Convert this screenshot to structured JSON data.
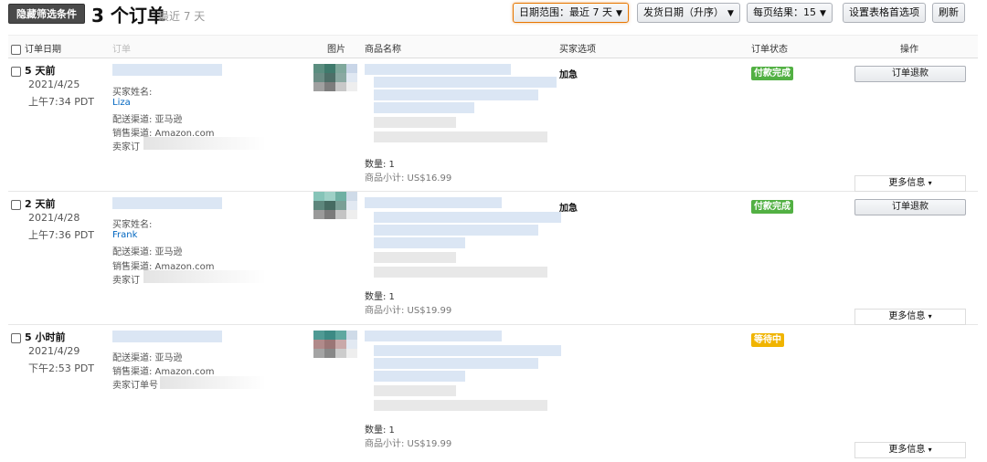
{
  "toolbar": {
    "hide_filters_label": "隐藏筛选条件",
    "order_count": "3 个订单",
    "range_note": "最近 7 天",
    "date_range_label": "日期范围：最近 7 天",
    "sort_label": "发货日期（升序）",
    "per_page_label": "每页结果：15",
    "table_prefs_label": "设置表格首选项",
    "refresh_label": "刷新"
  },
  "table": {
    "headers": {
      "order_date": "订单日期",
      "order_details": "订单",
      "image": "图片",
      "product_name": "商品名称",
      "buyer_options": "买家选项",
      "order_status": "订单状态",
      "actions": "操作"
    }
  },
  "orders": [
    {
      "relative_date": "5 天前",
      "date": "2021/4/25",
      "time": "上午7:34 PDT",
      "buyer_label": "买家姓名:",
      "buyer_name": "Liza",
      "fulfillment": "配送渠道: 亚马逊",
      "sales_channel": "销售渠道: Amazon.com",
      "seller_order": "卖家订",
      "quantity": "数量: 1",
      "subtotal": "商品小计: US$16.99",
      "buyer_option": "加急",
      "status": "付款完成",
      "status_color": "#52b043",
      "refund_label": "订单退款",
      "more_label": "更多信息"
    },
    {
      "relative_date": "2 天前",
      "date": "2021/4/28",
      "time": "上午7:36 PDT",
      "buyer_label": "买家姓名:",
      "buyer_name": "Frank",
      "fulfillment": "配送渠道: 亚马逊",
      "sales_channel": "销售渠道: Amazon.com",
      "seller_order": "卖家订",
      "quantity": "数量: 1",
      "subtotal": "商品小计: US$19.99",
      "buyer_option": "加急",
      "status": "付款完成",
      "status_color": "#52b043",
      "refund_label": "订单退款",
      "more_label": "更多信息"
    },
    {
      "relative_date": "5 小时前",
      "date": "2021/4/29",
      "time": "下午2:53 PDT",
      "fulfillment": "配送渠道: 亚马逊",
      "sales_channel": "销售渠道: Amazon.com",
      "seller_order": "卖家订单号",
      "quantity": "数量: 1",
      "subtotal": "商品小计: US$19.99",
      "status": "等待中",
      "status_color": "#f0b400",
      "more_label": "更多信息"
    }
  ]
}
